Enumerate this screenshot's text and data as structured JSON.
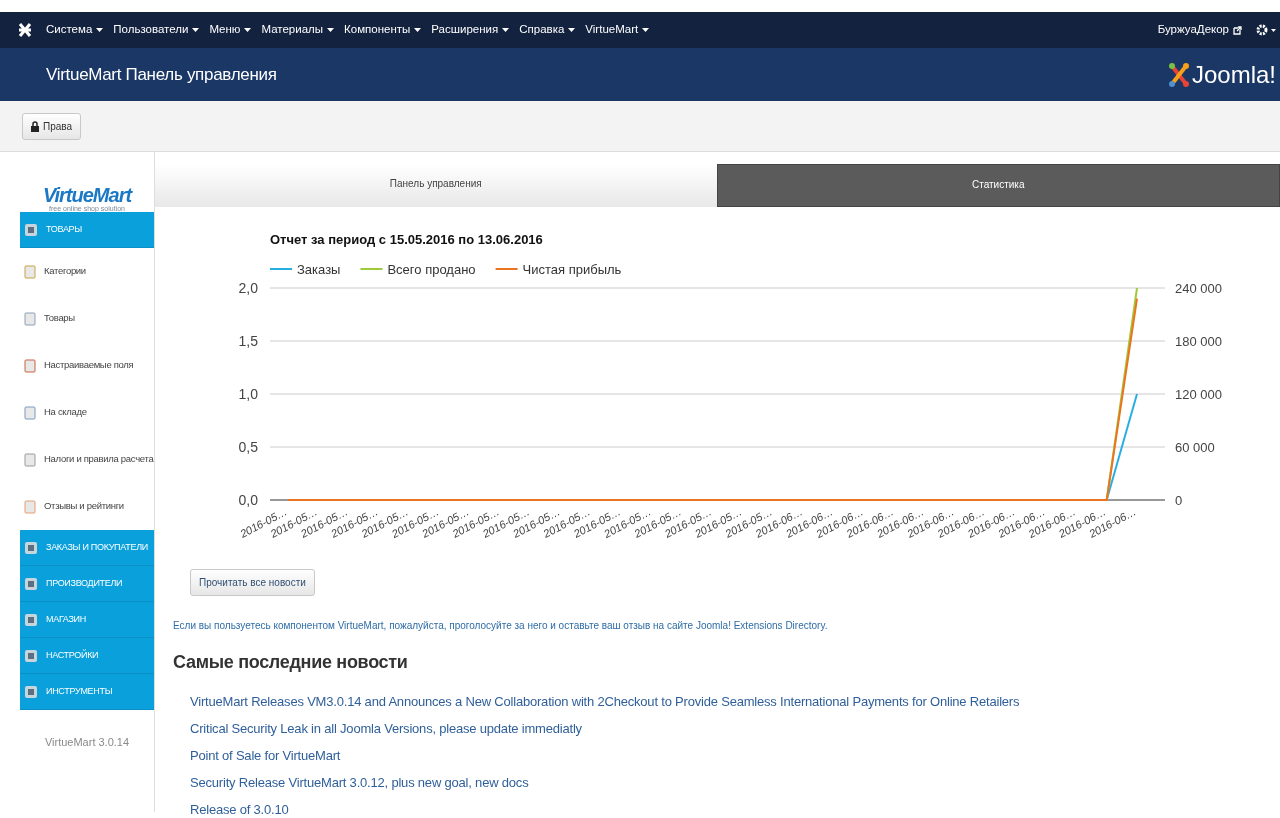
{
  "top_menu": {
    "items": [
      "Система",
      "Пользователи",
      "Меню",
      "Материалы",
      "Компоненты",
      "Расширения",
      "Справка",
      "VirtueMart"
    ],
    "site_link": "БуржуаДекор"
  },
  "header": {
    "title": "VirtueMart Панель управления",
    "logo_text": "Joomla!"
  },
  "toolbar": {
    "buttons": [
      "Права"
    ]
  },
  "sidebar": {
    "logo": "VirtueMart",
    "logo_tagline": "free online shop solution",
    "sections": [
      {
        "label": "ТОВАРЫ",
        "children": [
          {
            "label": "Категории"
          },
          {
            "label": "Товары"
          },
          {
            "label": "Настраиваемые поля"
          },
          {
            "label": "На складе"
          },
          {
            "label": "Налоги и правила расчета"
          },
          {
            "label": "Отзывы и рейтинги"
          }
        ]
      },
      {
        "label": "ЗАКАЗЫ И ПОКУПАТЕЛИ"
      },
      {
        "label": "ПРОИЗВОДИТЕЛИ"
      },
      {
        "label": "МАГАЗИН"
      },
      {
        "label": "НАСТРОЙКИ"
      },
      {
        "label": "ИНСТРУМЕНТЫ"
      }
    ],
    "version": "VirtueMart 3.0.14"
  },
  "tabs": [
    {
      "label": "Панель управления",
      "selected": true
    },
    {
      "label": "Статистика",
      "selected": false
    }
  ],
  "report": {
    "chart_data": {
      "type": "line",
      "title": "Отчет за период с 15.05.2016 по 13.06.2016",
      "categories": [
        "2016-05…",
        "2016-05…",
        "2016-05…",
        "2016-05…",
        "2016-05…",
        "2016-05…",
        "2016-05…",
        "2016-05…",
        "2016-05…",
        "2016-05…",
        "2016-05…",
        "2016-05…",
        "2016-05…",
        "2016-05…",
        "2016-05…",
        "2016-05…",
        "2016-05…",
        "2016-06…",
        "2016-06…",
        "2016-06…",
        "2016-06…",
        "2016-06…",
        "2016-06…",
        "2016-06…",
        "2016-06…",
        "2016-06…",
        "2016-06…",
        "2016-06…",
        "2016-06…"
      ],
      "series": [
        {
          "name": "Заказы",
          "color": "#29aee3",
          "values": [
            null,
            null,
            null,
            null,
            null,
            null,
            null,
            null,
            null,
            null,
            null,
            null,
            null,
            null,
            null,
            null,
            null,
            null,
            null,
            null,
            null,
            null,
            null,
            null,
            null,
            null,
            null,
            0,
            1
          ]
        },
        {
          "name": "Всего продано",
          "color": "#9fcb3a",
          "axis": "y2",
          "values": [
            null,
            null,
            null,
            null,
            null,
            null,
            null,
            null,
            null,
            null,
            null,
            null,
            null,
            null,
            null,
            null,
            null,
            null,
            null,
            null,
            null,
            null,
            null,
            null,
            null,
            null,
            null,
            0,
            240000
          ]
        },
        {
          "name": "Чистая прибыль",
          "color": "#ea7420",
          "axis": "y2",
          "values": [
            0,
            0,
            0,
            0,
            0,
            0,
            0,
            0,
            0,
            0,
            0,
            0,
            0,
            0,
            0,
            0,
            0,
            0,
            0,
            0,
            0,
            0,
            0,
            0,
            0,
            0,
            0,
            0,
            228000
          ]
        }
      ],
      "grid": true,
      "legend": "top",
      "ylim": [
        0,
        2
      ],
      "yticks": [
        {
          "value": 0,
          "label": "0,0"
        },
        {
          "value": 0.5,
          "label": "0,5"
        },
        {
          "value": 1,
          "label": "1,0"
        },
        {
          "value": 1.5,
          "label": "1,5"
        },
        {
          "value": 2,
          "label": "2,0"
        }
      ],
      "y2lim": [
        0,
        240000
      ],
      "y2ticks": [
        {
          "value": 0,
          "label": "0"
        },
        {
          "value": 60000,
          "label": "60 000"
        },
        {
          "value": 120000,
          "label": "120 000"
        },
        {
          "value": 180000,
          "label": "180 000"
        },
        {
          "value": 240000,
          "label": "240 000"
        }
      ]
    }
  },
  "news_button": "Прочитать все новости",
  "vote_note": "Если вы пользуетесь компонентом VirtueMart, пожалуйста, проголосуйте за него и оставьте ваш отзыв на сайте Joomla! Extensions Directory.",
  "news": {
    "heading": "Самые последние новости",
    "items": [
      "VirtueMart Releases VM3.0.14 and Announces a New Collaboration with 2Checkout to Provide Seamless International Payments for Online Retailers",
      "Critical Security Leak in all Joomla Versions, please update immediatly",
      "Point of Sale for VirtueMart",
      "Security Release VirtueMart 3.0.12, plus new goal, new docs",
      "Release of 3.0.10"
    ]
  }
}
